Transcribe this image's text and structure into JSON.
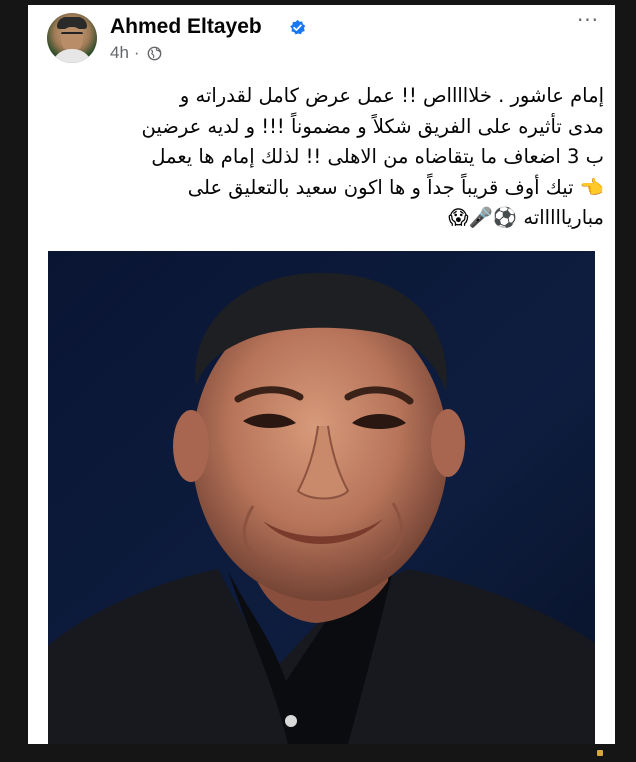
{
  "post": {
    "author_name": "Ahmed Eltayeb",
    "timestamp": "4h",
    "separator": "·",
    "more_label": "···",
    "body_lines": [
      "إمام عاشور .  خلاااااص  !!  عمل عرض كامل لقدراته و",
      "مدى تأثيره على الفريق شكلاً و مضموناً !!!  و لديه عرضين",
      "ب 3 اضعاف ما يتقاضاه من الاهلى !! لذلك إمام  ها يعمل",
      "👈 تيك أوف  قريباً جداً و ها اكون سعيد بالتعليق على",
      "مبارياااااته ⚽🎤😱"
    ]
  },
  "icons": {
    "verified": "verified-badge-icon",
    "audience": "globe-icon",
    "more": "more-options-icon"
  },
  "colors": {
    "verified_blue": "#1877f2",
    "meta_gray": "#65676b",
    "photo_background": "#0b1838"
  }
}
